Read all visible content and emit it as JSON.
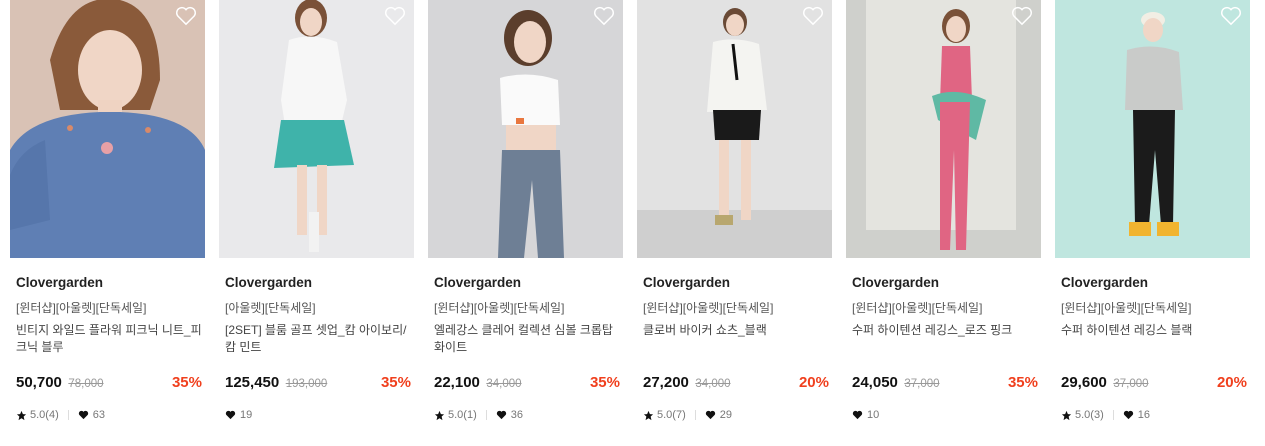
{
  "products": [
    {
      "brand": "Clovergarden",
      "tag": "[윈터샵][아울렛][단독세일]",
      "title": "빈티지 와일드 플라워 피크닉 니트_피크닉 블루",
      "price": "50,700",
      "original_price": "78,000",
      "discount": "35%",
      "rating": "5.0(4)",
      "likes": "63",
      "photo_bg": "#d9c2b5",
      "outfit": "#5f7fb4"
    },
    {
      "brand": "Clovergarden",
      "tag": "[아울렛][단독세일]",
      "title": "[2SET] 블룸 골프 셋업_캄 아이보리/캄 민트",
      "price": "125,450",
      "original_price": "193,000",
      "discount": "35%",
      "rating": "",
      "likes": "19",
      "photo_bg": "#e9e9eb",
      "outfit": "#3fb3aa"
    },
    {
      "brand": "Clovergarden",
      "tag": "[윈터샵][아울렛][단독세일]",
      "title": "엘레강스 클레어 컬렉션 심볼 크롭탑 화이트",
      "price": "22,100",
      "original_price": "34,000",
      "discount": "35%",
      "rating": "5.0(1)",
      "likes": "36",
      "photo_bg": "#d6d6d8",
      "outfit": "#6e7f95"
    },
    {
      "brand": "Clovergarden",
      "tag": "[윈터샵][아울렛][단독세일]",
      "title": "클로버 바이커 쇼츠_블랙",
      "price": "27,200",
      "original_price": "34,000",
      "discount": "20%",
      "rating": "5.0(7)",
      "likes": "29",
      "photo_bg": "#e2e2e2",
      "outfit": "#1a1a1a"
    },
    {
      "brand": "Clovergarden",
      "tag": "[윈터샵][아울렛][단독세일]",
      "title": "수퍼 하이텐션 레깅스_로즈 핑크",
      "price": "24,050",
      "original_price": "37,000",
      "discount": "35%",
      "rating": "",
      "likes": "10",
      "photo_bg": "#cfd0cc",
      "outfit": "#e06583"
    },
    {
      "brand": "Clovergarden",
      "tag": "[윈터샵][아울렛][단독세일]",
      "title": "수퍼 하이텐션 레깅스 블랙",
      "price": "29,600",
      "original_price": "37,000",
      "discount": "20%",
      "rating": "5.0(3)",
      "likes": "16",
      "photo_bg": "#bfe6df",
      "outfit": "#1b1b1b"
    }
  ],
  "colors": {
    "discount": "#f0401e",
    "strike": "#999999"
  }
}
